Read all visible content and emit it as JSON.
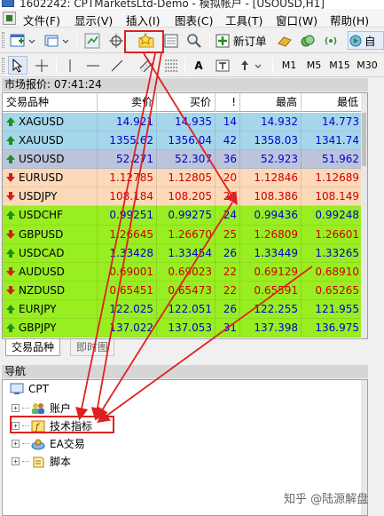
{
  "window": {
    "title": "1602242: CPTMarketsLtd-Demo - 模拟帐户 - [USOUSD,H1]"
  },
  "menu": {
    "items": [
      "文件(F)",
      "显示(V)",
      "插入(I)",
      "图表(C)",
      "工具(T)",
      "窗口(W)",
      "帮助(H)"
    ]
  },
  "toolbar1": {
    "new_order_label": "新订单",
    "auto_trading_label": "自"
  },
  "toolbar2": {
    "timeframes": [
      "M1",
      "M5",
      "M15",
      "M30"
    ]
  },
  "market_watch": {
    "title": "市场报价: 07:41:24",
    "columns": [
      "交易品种",
      "卖价",
      "买价",
      "!",
      "最高",
      "最低"
    ],
    "rows": [
      {
        "symbol": "XAGUSD",
        "dir": "up",
        "bid": "14.921",
        "ask": "14.935",
        "spread": "14",
        "high": "14.932",
        "low": "14.773",
        "bg": "#a6d6ec",
        "fg": "#0000cc"
      },
      {
        "symbol": "XAUUSD",
        "dir": "up",
        "bid": "1355.62",
        "ask": "1356.04",
        "spread": "42",
        "high": "1358.03",
        "low": "1341.74",
        "bg": "#a6d6ec",
        "fg": "#0000cc"
      },
      {
        "symbol": "USOUSD",
        "dir": "up",
        "bid": "52.271",
        "ask": "52.307",
        "spread": "36",
        "high": "52.923",
        "low": "51.962",
        "bg": "#bcc4dc",
        "fg": "#0000cc"
      },
      {
        "symbol": "EURUSD",
        "dir": "down",
        "bid": "1.12785",
        "ask": "1.12805",
        "spread": "20",
        "high": "1.12846",
        "low": "1.12689",
        "bg": "#fcd9b8",
        "fg": "#cc0000"
      },
      {
        "symbol": "USDJPY",
        "dir": "down",
        "bid": "108.184",
        "ask": "108.205",
        "spread": "21",
        "high": "108.386",
        "low": "108.149",
        "bg": "#fcd9b8",
        "fg": "#cc0000"
      },
      {
        "symbol": "USDCHF",
        "dir": "up",
        "bid": "0.99251",
        "ask": "0.99275",
        "spread": "24",
        "high": "0.99436",
        "low": "0.99248",
        "bg": "#99ee22",
        "fg": "#0000cc"
      },
      {
        "symbol": "GBPUSD",
        "dir": "down",
        "bid": "1.26645",
        "ask": "1.26670",
        "spread": "25",
        "high": "1.26809",
        "low": "1.26601",
        "bg": "#99ee22",
        "fg": "#cc0000"
      },
      {
        "symbol": "USDCAD",
        "dir": "up",
        "bid": "1.33428",
        "ask": "1.33454",
        "spread": "26",
        "high": "1.33449",
        "low": "1.33265",
        "bg": "#99ee22",
        "fg": "#0000cc"
      },
      {
        "symbol": "AUDUSD",
        "dir": "down",
        "bid": "0.69001",
        "ask": "0.69023",
        "spread": "22",
        "high": "0.69129",
        "low": "0.68910",
        "bg": "#99ee22",
        "fg": "#cc0000"
      },
      {
        "symbol": "NZDUSD",
        "dir": "down",
        "bid": "0.65451",
        "ask": "0.65473",
        "spread": "22",
        "high": "0.65591",
        "low": "0.65265",
        "bg": "#99ee22",
        "fg": "#cc0000"
      },
      {
        "symbol": "EURJPY",
        "dir": "up",
        "bid": "122.025",
        "ask": "122.051",
        "spread": "26",
        "high": "122.255",
        "low": "121.955",
        "bg": "#99ee22",
        "fg": "#0000cc"
      },
      {
        "symbol": "GBPJPY",
        "dir": "up",
        "bid": "137.022",
        "ask": "137.053",
        "spread": "31",
        "high": "137.398",
        "low": "136.975",
        "bg": "#99ee22",
        "fg": "#0000cc"
      }
    ],
    "tabs": [
      "交易品种",
      "即时图"
    ]
  },
  "navigator": {
    "title": "导航",
    "root": "CPT",
    "items": [
      "账户",
      "技术指标",
      "EA交易",
      "脚本"
    ]
  },
  "watermark": {
    "text": "知乎 @陆源解盘"
  },
  "colors": {
    "annotation_red": "#e02020"
  }
}
